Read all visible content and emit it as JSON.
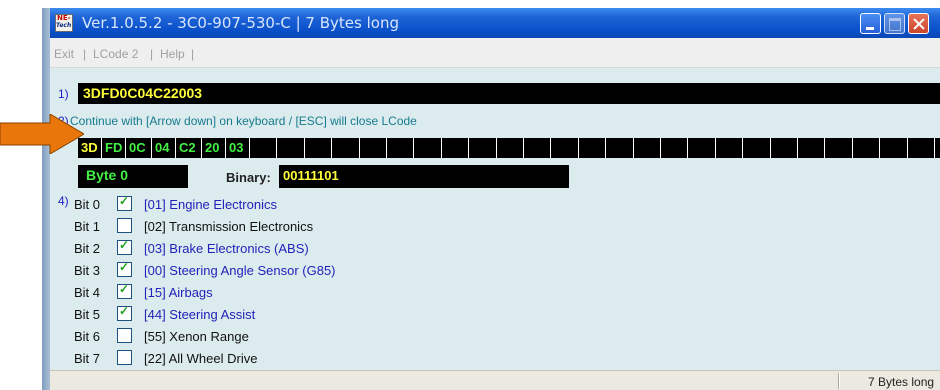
{
  "window": {
    "title": "Ver.1.0.5.2 -   3C0-907-530-C  |  7 Bytes long",
    "icon_top": "NE-",
    "icon_bottom": "Tech"
  },
  "menu": {
    "items": [
      "Exit",
      "LCode 2",
      "Help"
    ],
    "separator": "|"
  },
  "section1": {
    "number": "1)",
    "code": "3DFD0C04C22003"
  },
  "section2": {
    "number": "2)",
    "instruction": "Continue with [Arrow down] on keyboard / [ESC] will close LCode"
  },
  "bytes": [
    "3D",
    "FD",
    "0C",
    "04",
    "C2",
    "20",
    "03",
    "",
    "",
    "",
    "",
    "",
    "",
    "",
    "",
    "",
    "",
    "",
    "",
    "",
    "",
    "",
    "",
    "",
    "",
    "",
    "",
    "",
    "",
    "",
    "",
    ""
  ],
  "byte_info": {
    "label": "Byte 0",
    "binary_label": "Binary:",
    "binary_value": "00111101"
  },
  "section4": {
    "number": "4)",
    "bits": [
      {
        "label": "Bit 0",
        "checked": true,
        "text": "[01] Engine Electronics"
      },
      {
        "label": "Bit 1",
        "checked": false,
        "text": "[02] Transmission Electronics"
      },
      {
        "label": "Bit 2",
        "checked": true,
        "text": "[03] Brake Electronics (ABS)"
      },
      {
        "label": "Bit 3",
        "checked": true,
        "text": "[00] Steering Angle Sensor (G85)"
      },
      {
        "label": "Bit 4",
        "checked": true,
        "text": "[15] Airbags"
      },
      {
        "label": "Bit 5",
        "checked": true,
        "text": "[44] Steering Assist"
      },
      {
        "label": "Bit 6",
        "checked": false,
        "text": "[55] Xenon Range"
      },
      {
        "label": "Bit 7",
        "checked": false,
        "text": "[22] All Wheel Drive"
      }
    ]
  },
  "status": {
    "text": "7 Bytes long"
  },
  "colors": {
    "checked_text": "#2222bb",
    "unchecked_text": "#111111",
    "arrow": "#e8760a"
  }
}
